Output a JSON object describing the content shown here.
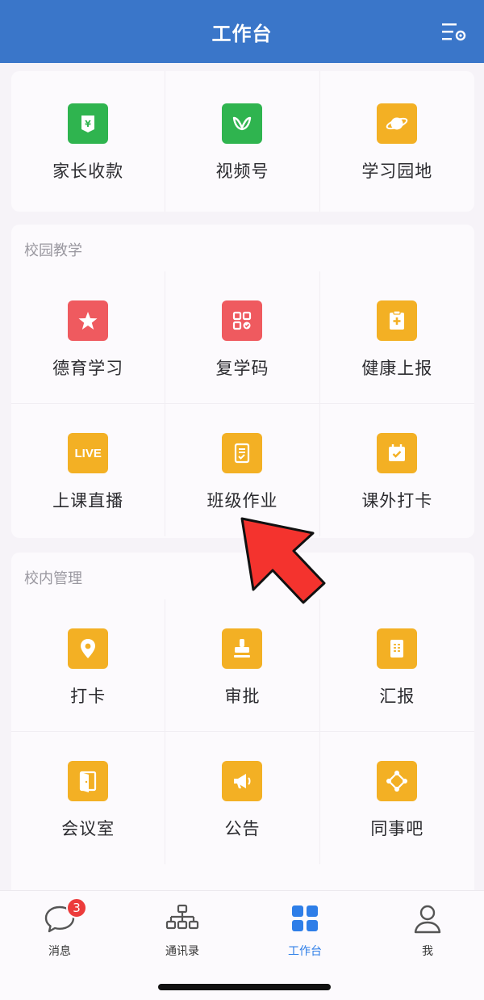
{
  "header": {
    "title": "工作台"
  },
  "section_top": {
    "items": [
      {
        "label": "家长收款",
        "icon": "yuan-tag-icon",
        "color": "#2fb44f"
      },
      {
        "label": "视频号",
        "icon": "butterfly-icon",
        "color": "#2fb44f"
      },
      {
        "label": "学习园地",
        "icon": "planet-icon",
        "color": "#f3b024"
      }
    ]
  },
  "section_teaching": {
    "title": "校园教学",
    "items": [
      {
        "label": "德育学习",
        "icon": "star-icon",
        "color": "#ef5a5f"
      },
      {
        "label": "复学码",
        "icon": "qr-code-icon",
        "color": "#ef5a5f"
      },
      {
        "label": "健康上报",
        "icon": "medical-clipboard-icon",
        "color": "#f3b024"
      },
      {
        "label": "上课直播",
        "icon": "live-icon",
        "icon_text": "LIVE",
        "color": "#f3b024"
      },
      {
        "label": "班级作业",
        "icon": "homework-icon",
        "color": "#f3b024"
      },
      {
        "label": "课外打卡",
        "icon": "calendar-check-icon",
        "color": "#f3b024"
      }
    ]
  },
  "section_management": {
    "title": "校内管理",
    "items": [
      {
        "label": "打卡",
        "icon": "location-pin-icon",
        "color": "#f3b024"
      },
      {
        "label": "审批",
        "icon": "stamp-icon",
        "color": "#f3b024"
      },
      {
        "label": "汇报",
        "icon": "report-icon",
        "color": "#f3b024"
      },
      {
        "label": "会议室",
        "icon": "door-icon",
        "color": "#f3b024"
      },
      {
        "label": "公告",
        "icon": "megaphone-icon",
        "color": "#f3b024"
      },
      {
        "label": "同事吧",
        "icon": "network-icon",
        "color": "#f3b024"
      }
    ]
  },
  "tabbar": {
    "items": [
      {
        "label": "消息",
        "icon": "chat-bubble-icon",
        "badge": "3"
      },
      {
        "label": "通讯录",
        "icon": "org-chart-icon"
      },
      {
        "label": "工作台",
        "icon": "grid-icon",
        "active": true
      },
      {
        "label": "我",
        "icon": "person-icon"
      }
    ]
  },
  "colors": {
    "header": "#3a76c9",
    "active_tab": "#2e7ee8",
    "arrow": "#f4332e"
  }
}
